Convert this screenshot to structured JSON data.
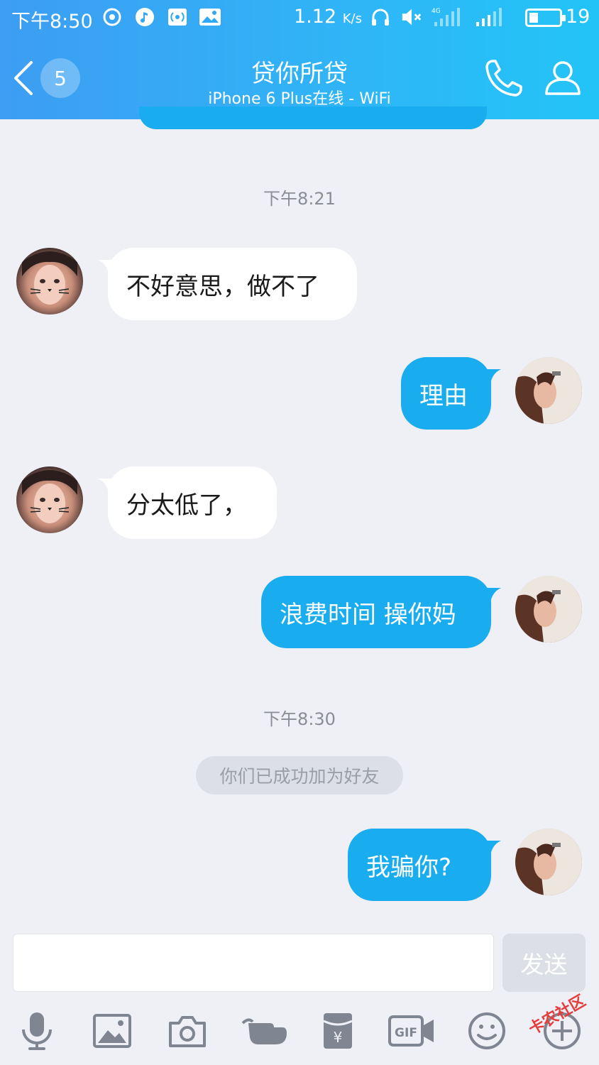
{
  "status_bar": {
    "time": "下午8:50",
    "speed": "1.12",
    "speed_unit": "K/s",
    "network_label": "4G",
    "battery": "19"
  },
  "nav": {
    "unread_count": "5",
    "title": "贷你所贷",
    "subtitle": "iPhone 6 Plus在线 - WiFi"
  },
  "chat": {
    "timestamp_1": "下午8:21",
    "timestamp_2": "下午8:30",
    "system_notice": "你们已成功加为好友",
    "messages": [
      {
        "side": "in",
        "text": "不好意思，做不了"
      },
      {
        "side": "out",
        "text": "理由"
      },
      {
        "side": "in",
        "text": "分太低了，"
      },
      {
        "side": "out",
        "text": "浪费时间 操你妈"
      },
      {
        "side": "out",
        "text": "我骗你?"
      }
    ]
  },
  "input": {
    "value": "",
    "placeholder": "",
    "send_label": "发送"
  },
  "toolbar": {
    "items": [
      "microphone-icon",
      "image-icon",
      "camera-icon",
      "poke-icon",
      "red-packet-icon",
      "gif-icon",
      "emoji-icon",
      "plus-icon"
    ]
  },
  "watermark": "卡农社区",
  "colors": {
    "header_start": "#3d9df2",
    "header_end": "#22c4f7",
    "bubble_out": "#19acef",
    "bubble_in": "#ffffff",
    "background": "#eef0f6"
  }
}
